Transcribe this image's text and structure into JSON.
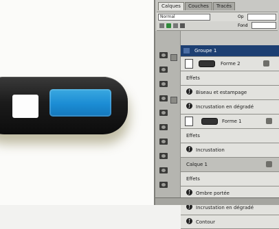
{
  "canvas": {
    "blue_color": "#1b8cd4",
    "button_color": "#1b1b1b"
  },
  "panel": {
    "tabs": [
      {
        "label": "Calques"
      },
      {
        "label": "Couches"
      },
      {
        "label": "Tracés"
      }
    ],
    "blend_mode": "Normal",
    "opacity_label": "Op",
    "fill_label": "Fond"
  },
  "layers": {
    "header_label": "Groupe 1",
    "row_forme_2": "Forme 2",
    "effets_1": "Effets",
    "biseau_1": "Biseau et estampage",
    "incrustation_1": "Incrustation en dégradé",
    "row_forme_1": "Forme 1",
    "effets_2": "Effets",
    "incrustation_2": "Incrustation",
    "group_label": "Calque 1",
    "effets_3": "Effets",
    "ombre_portee": "Ombre portée",
    "incrustation_3": "Incrustation en dégradé",
    "contour": "Contour"
  }
}
